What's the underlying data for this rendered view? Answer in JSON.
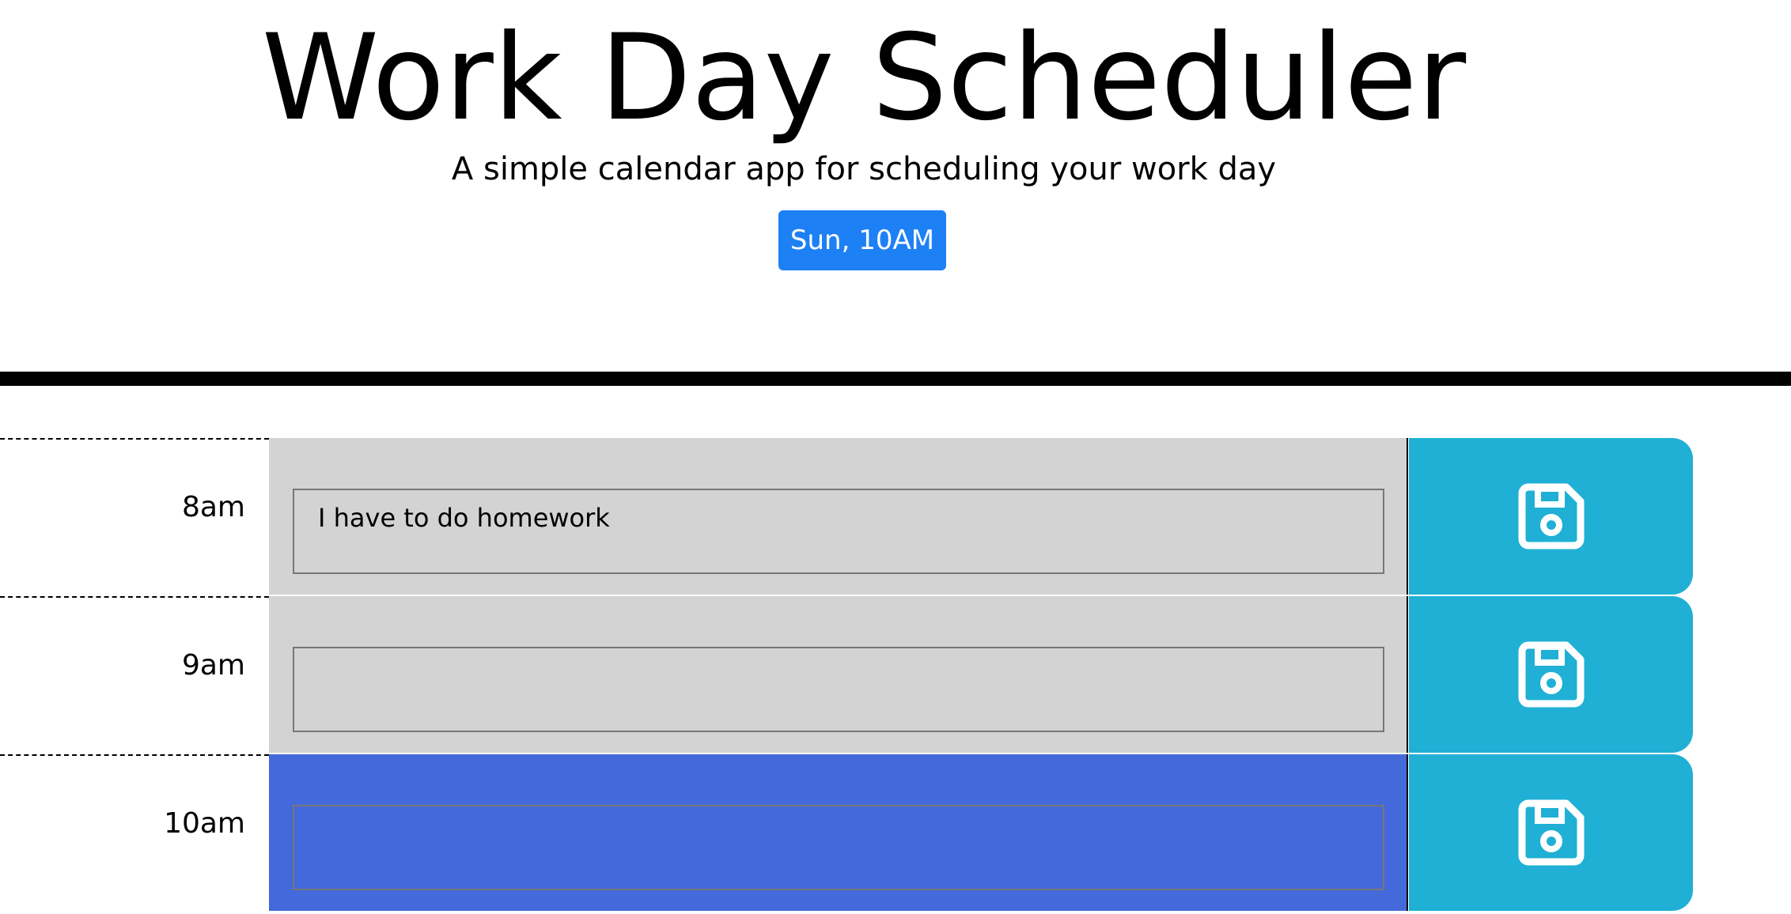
{
  "header": {
    "title": "Work Day Scheduler",
    "subtitle": "A simple calendar app for scheduling your work day",
    "current_day": "Sun, 10AM"
  },
  "rows": [
    {
      "hour": "8am",
      "task": "I have to do homework",
      "state": "past"
    },
    {
      "hour": "9am",
      "task": "",
      "state": "past"
    },
    {
      "hour": "10am",
      "task": "",
      "state": "present"
    }
  ],
  "colors": {
    "past": "#d3d3d3",
    "present": "#4469da",
    "save": "#20b0d5",
    "badge": "#1e80f5"
  },
  "icons": {
    "save": "floppy-disk-icon"
  }
}
